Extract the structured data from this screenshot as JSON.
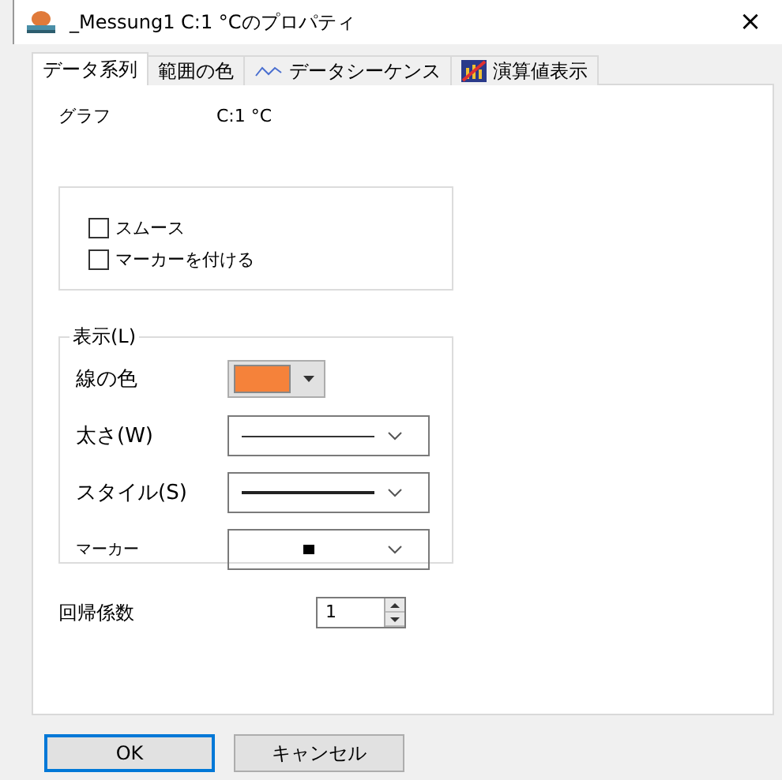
{
  "window": {
    "title": "_Messung1 C:1 °Cのプロパティ",
    "close": "×"
  },
  "tabs": [
    {
      "label": "データ系列",
      "selected": true,
      "kind": "plain"
    },
    {
      "label": "範囲の色",
      "selected": false,
      "kind": "plain"
    },
    {
      "label": "データシーケンス",
      "selected": false,
      "kind": "wave"
    },
    {
      "label": "演算値表示",
      "selected": false,
      "kind": "chart"
    }
  ],
  "graph": {
    "label": "グラフ",
    "value": "C:1 °C"
  },
  "options": [
    {
      "label": "スムース",
      "checked": false
    },
    {
      "label": "マーカーを付ける",
      "checked": false
    }
  ],
  "display": {
    "legend": "表示(L)",
    "fields": [
      {
        "label": "線の色",
        "kind": "color",
        "color": "#f5823a"
      },
      {
        "label": "太さ(W)",
        "kind": "thin"
      },
      {
        "label": "スタイル(S)",
        "kind": "thick"
      },
      {
        "label": "マーカー",
        "kind": "marker"
      }
    ]
  },
  "regression": {
    "label": "回帰係数",
    "value": "1"
  },
  "buttons": [
    {
      "label": "OK",
      "kind": "default"
    },
    {
      "label": "キャンセル",
      "kind": "normal"
    }
  ]
}
